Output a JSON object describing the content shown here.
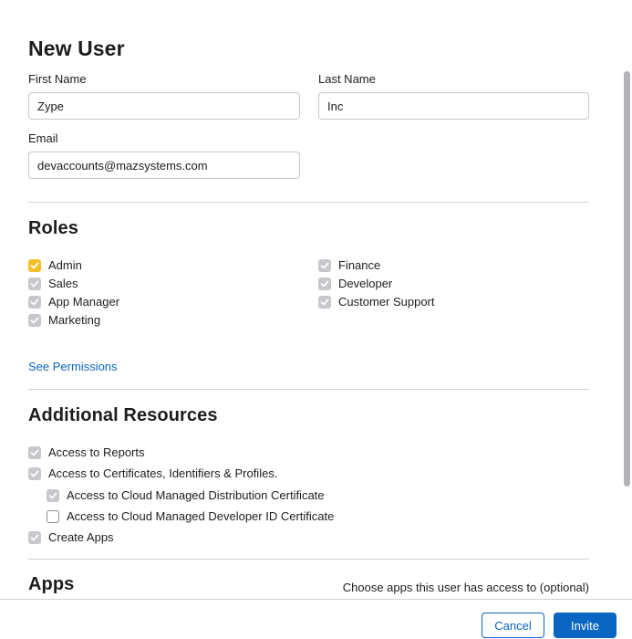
{
  "form": {
    "title": "New User",
    "first_name": {
      "label": "First Name",
      "value": "Zype"
    },
    "last_name": {
      "label": "Last Name",
      "value": "Inc"
    },
    "email": {
      "label": "Email",
      "value": "devaccounts@mazsystems.com"
    }
  },
  "roles": {
    "heading": "Roles",
    "items": [
      {
        "label": "Admin",
        "checked": true,
        "color": "#f5bf2a"
      },
      {
        "label": "Sales",
        "checked": true
      },
      {
        "label": "App Manager",
        "checked": true
      },
      {
        "label": "Marketing",
        "checked": true
      },
      {
        "label": "Finance",
        "checked": true
      },
      {
        "label": "Developer",
        "checked": true
      },
      {
        "label": "Customer Support",
        "checked": true
      }
    ],
    "see_permissions": "See Permissions"
  },
  "resources": {
    "heading": "Additional Resources",
    "items": [
      {
        "label": "Access to Reports",
        "checked": true
      },
      {
        "label": "Access to Certificates, Identifiers & Profiles.",
        "checked": true
      },
      {
        "label": "Access to Cloud Managed Distribution Certificate",
        "checked": true
      },
      {
        "label": "Access to Cloud Managed Developer ID Certificate",
        "checked": false
      },
      {
        "label": "Create Apps",
        "checked": true
      }
    ]
  },
  "apps": {
    "heading": "Apps",
    "hint": "Choose apps this user has access to (optional)"
  },
  "footer": {
    "cancel_label": "Cancel",
    "invite_label": "Invite"
  },
  "colors": {
    "accent": "#0a66c2",
    "checked_gray": "#c7c7cc",
    "admin_yellow": "#f5bf2a"
  }
}
